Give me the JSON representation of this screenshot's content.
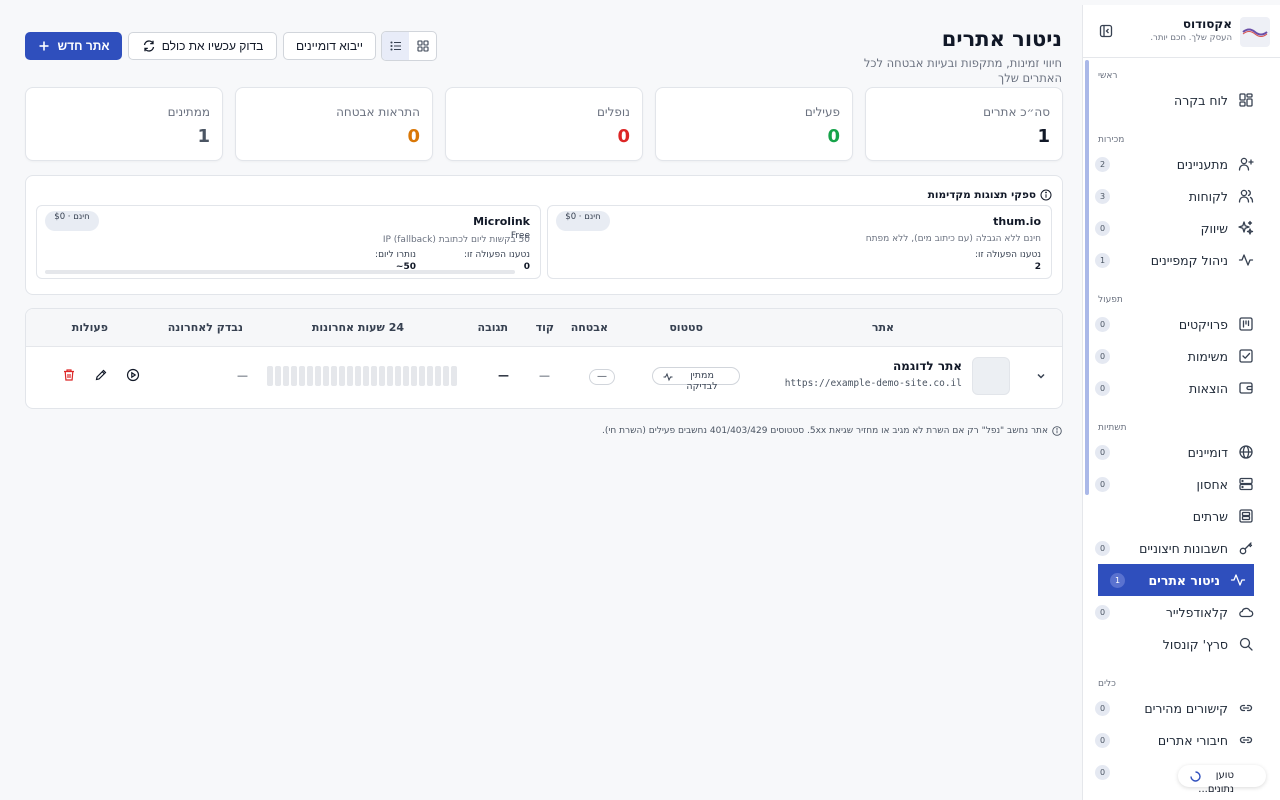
{
  "brand": {
    "name": "אקסודוס",
    "tagline": "העסק שלך. חכם יותר."
  },
  "sidebar": {
    "sections": [
      {
        "title": "ראשי",
        "items": [
          {
            "label": "לוח בקרה",
            "icon": "dashboard-icon",
            "count": ""
          }
        ]
      },
      {
        "title": "מכירות",
        "items": [
          {
            "label": "מתעניינים",
            "icon": "user-plus-icon",
            "count": "2"
          },
          {
            "label": "לקוחות",
            "icon": "users-icon",
            "count": "3"
          },
          {
            "label": "שיווק",
            "icon": "sparkles-icon",
            "count": "0"
          },
          {
            "label": "ניהול קמפיינים",
            "icon": "activity-icon",
            "count": "1"
          }
        ]
      },
      {
        "title": "תפעול",
        "items": [
          {
            "label": "פרויקטים",
            "icon": "kanban-icon",
            "count": "0"
          },
          {
            "label": "משימות",
            "icon": "checkbox-icon",
            "count": "0"
          },
          {
            "label": "הוצאות",
            "icon": "wallet-icon",
            "count": "0"
          }
        ]
      },
      {
        "title": "תשתיות",
        "items": [
          {
            "label": "דומיינים",
            "icon": "globe-icon",
            "count": "0"
          },
          {
            "label": "אחסון",
            "icon": "server-icon",
            "count": "0"
          },
          {
            "label": "שרתים",
            "icon": "server-square-icon",
            "count": ""
          },
          {
            "label": "חשבונות חיצוניים",
            "icon": "key-icon",
            "count": "0"
          },
          {
            "label": "ניטור אתרים",
            "icon": "pulse-icon",
            "count": "1",
            "active": true
          },
          {
            "label": "קלאודפלייר",
            "icon": "cloud-icon",
            "count": "0"
          },
          {
            "label": "סרץ' קונסול",
            "icon": "search-icon",
            "count": ""
          }
        ]
      },
      {
        "title": "כלים",
        "items": [
          {
            "label": "קישורים מהירים",
            "icon": "link-icon",
            "count": "0"
          },
          {
            "label": "חיבורי אתרים",
            "icon": "link-icon",
            "count": "0"
          },
          {
            "label": "",
            "icon": "",
            "count": "0"
          }
        ]
      }
    ]
  },
  "header": {
    "title": "ניטור אתרים",
    "subtitle": "חיווי זמינות, מתקפות ובעיות אבטחה לכל האתרים שלך"
  },
  "toolbar": {
    "new_site": "אתר חדש",
    "check_all": "בדוק עכשיו את כולם",
    "import_domains": "ייבוא דומיינים"
  },
  "stats": [
    {
      "label": "סה״כ אתרים",
      "value": "1",
      "color": "#111827"
    },
    {
      "label": "פעילים",
      "value": "0",
      "color": "#16a34a"
    },
    {
      "label": "נופלים",
      "value": "0",
      "color": "#dc2626"
    },
    {
      "label": "התראות אבטחה",
      "value": "0",
      "color": "#d97706"
    },
    {
      "label": "ממתינים",
      "value": "1",
      "color": "#4b5563"
    }
  ],
  "providers": {
    "title": "ספקי תצוגות מקדימות",
    "cards": [
      {
        "name": "thum.io",
        "badge": "חינם · $0",
        "desc": "חינם ללא הגבלה (עם כיתוב מים), ללא מפתח",
        "used_label": "נטענו הפעולה זו:",
        "used_value": "2"
      },
      {
        "name": "Microlink",
        "badge": "חינם · $0",
        "plan": "Free",
        "desc": "50 בקשות ליום לכתובת IP (fallback)",
        "used_label": "נטענו הפעולה זו:",
        "used_value": "0",
        "remaining_label": "נותרו ליום:",
        "remaining_value": "~50"
      }
    ]
  },
  "table": {
    "columns": {
      "site": "אתר",
      "status": "סטטוס",
      "security": "אבטחה",
      "code": "קוד",
      "response": "תגובה",
      "last24": "24 שעות אחרונות",
      "last_checked": "נבדק לאחרונה",
      "actions": "פעולות"
    },
    "rows": [
      {
        "name": "אתר לדוגמה",
        "url": "https://example-demo-site.co.il",
        "status": "ממתין לבדיקה",
        "security": "—",
        "code": "—",
        "response": "—",
        "last_checked": "—"
      }
    ]
  },
  "footnote": "אתר נחשב \"נפל\" רק אם השרת לא מגיב או מחזיר שגיאת 5xx. סטטוסים 401/403/429 נחשבים פעילים (השרת חי).",
  "toast": {
    "text": "טוען נתונים..."
  }
}
